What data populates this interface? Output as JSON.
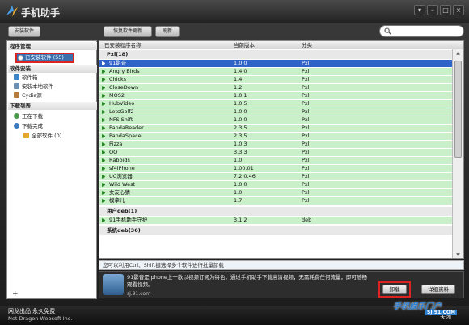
{
  "app": {
    "title": "手机助手"
  },
  "toolbar": {
    "install_label": "安装软件",
    "restore_label": "恢复软件更新",
    "refresh_label": "刷新",
    "search_placeholder": ""
  },
  "sidebar": {
    "sections": [
      {
        "title": "程序管理",
        "items": [
          {
            "label": "已安装软件 (55)",
            "icon": "installed-icon",
            "selected": true
          }
        ]
      },
      {
        "title": "软件安装",
        "items": [
          {
            "label": "软件箱",
            "icon": "box-icon"
          },
          {
            "label": "安装本地软件",
            "icon": "local-install-icon"
          },
          {
            "label": "Cydia源",
            "icon": "cydia-icon"
          }
        ]
      },
      {
        "title": "下载列表",
        "items": [
          {
            "label": "正在下载",
            "icon": "downloading-icon"
          },
          {
            "label": "下载完成",
            "icon": "downloaded-icon"
          },
          {
            "label": "全部软件 (0)",
            "icon": "all-software-icon"
          }
        ]
      }
    ],
    "add_label": "+"
  },
  "table": {
    "columns": [
      "已安装程序名称",
      "当前版本",
      "分类"
    ],
    "groups": [
      {
        "name": "Pxl(18)",
        "rows": [
          {
            "name": "91影音",
            "version": "1.0.0",
            "category": "Pxl",
            "selected": true
          },
          {
            "name": "Angry Birds",
            "version": "1.4.0",
            "category": "Pxl"
          },
          {
            "name": "Chicks",
            "version": "1.4",
            "category": "Pxl"
          },
          {
            "name": "CloseDown",
            "version": "1.2",
            "category": "Pxl"
          },
          {
            "name": "MOS2",
            "version": "1.0.1",
            "category": "Pxl"
          },
          {
            "name": "HubVideo",
            "version": "1.0.5",
            "category": "Pxl"
          },
          {
            "name": "LetsGolf2",
            "version": "1.0.0",
            "category": "Pxl"
          },
          {
            "name": "NFS Shift",
            "version": "1.0.0",
            "category": "Pxl"
          },
          {
            "name": "PandaReader",
            "version": "2.3.5",
            "category": "Pxl"
          },
          {
            "name": "PandaSpace",
            "version": "2.3.5",
            "category": "Pxl"
          },
          {
            "name": "Pizza",
            "version": "1.0.3",
            "category": "Pxl"
          },
          {
            "name": "QQ",
            "version": "3.3.3",
            "category": "Pxl"
          },
          {
            "name": "Rabbids",
            "version": "1.0",
            "category": "Pxl"
          },
          {
            "name": "sf4iPhone",
            "version": "1.00.01",
            "category": "Pxl"
          },
          {
            "name": "UC浏览器",
            "version": "7.2.0.46",
            "category": "Pxl"
          },
          {
            "name": "Wild West",
            "version": "1.0.0",
            "category": "Pxl"
          },
          {
            "name": "女友心猜",
            "version": "1.0",
            "category": "Pxl"
          },
          {
            "name": "模拿儿",
            "version": "1.7",
            "category": "Pxl"
          }
        ]
      },
      {
        "name": "用户deb(1)",
        "rows": [
          {
            "name": "91手机助手守护",
            "version": "3.1.2",
            "category": "deb"
          }
        ]
      },
      {
        "name": "系统deb(36)",
        "rows": []
      }
    ]
  },
  "hint": "您可以利用Ctrl、Shift键选择多个软件进行批量卸载",
  "detail": {
    "description": "91影音是iphone上一款以视频订阅为特色，通过手机助手下载高清视频，无需耗费任何流量，即可随畅观看视频。",
    "url": "sj.91.com",
    "uninstall_label": "卸载",
    "info_label": "详细资料"
  },
  "footer": {
    "line1": "网龙出品 永久免费",
    "line2": "Net Dragon Websoft Inc.",
    "exit_label": "关闭"
  },
  "watermark": {
    "line1": "手机娱乐门户",
    "line2": "SJ.91.COM"
  },
  "colors": {
    "selected_row": "#2f63c8",
    "row_bg": "#c9f0c9",
    "highlight_box": "#d22222"
  }
}
